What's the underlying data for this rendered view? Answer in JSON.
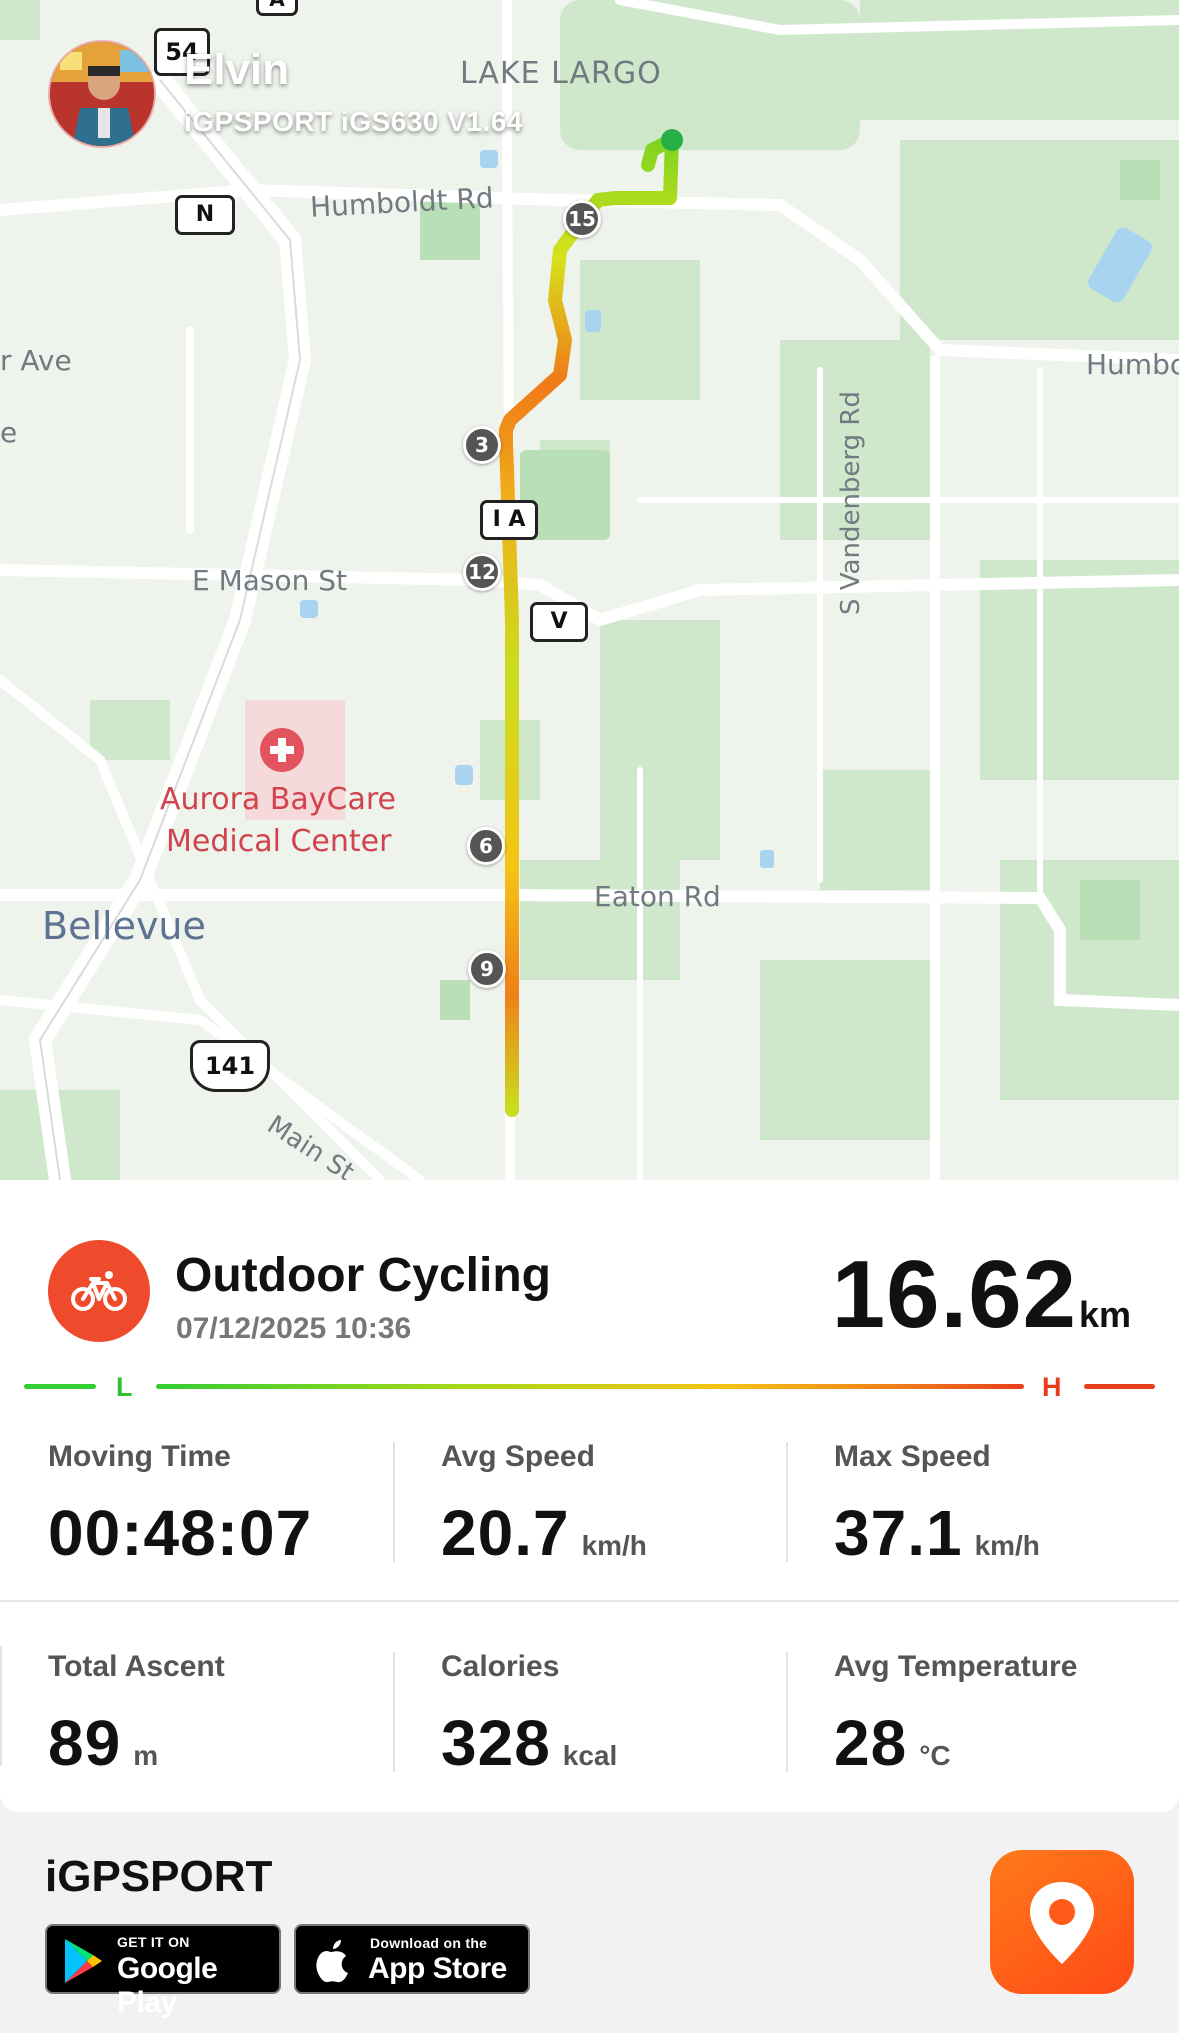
{
  "user": {
    "name": "Elvin",
    "device": "iGPSPORT iGS630 V1.64"
  },
  "map": {
    "labels": {
      "lake_largo": "LAKE LARGO",
      "humboldt_rd": "Humboldt Rd",
      "humboldt_east": "Humbo",
      "r_ave": "r Ave",
      "e_edge": "e",
      "e_mason_st": "E Mason St",
      "s_vandenberg_rd": "S Vandenberg Rd",
      "hospital_line1": "Aurora BayCare",
      "hospital_line2": "Medical Center",
      "bellevue": "Bellevue",
      "eaton_rd": "Eaton Rd",
      "main_st": "Main St"
    },
    "shields": {
      "a": "A",
      "n": "N",
      "s54": "54",
      "ia": "I A",
      "v": "V",
      "us141": "141"
    },
    "lap_markers": [
      "15",
      "3",
      "12",
      "6",
      "9"
    ]
  },
  "activity": {
    "title": "Outdoor Cycling",
    "datetime": "07/12/2025 10:36",
    "distance_value": "16.62",
    "distance_unit": "km",
    "icon": "bicycle-icon",
    "accent_color": "#ef4a2c"
  },
  "legend": {
    "low_label": "L",
    "high_label": "H",
    "low_color": "#32cd32",
    "high_color": "#e83d1d"
  },
  "stats": [
    {
      "label": "Moving Time",
      "value": "00:48:07",
      "unit": ""
    },
    {
      "label": "Avg Speed",
      "value": "20.7",
      "unit": "km/h"
    },
    {
      "label": "Max Speed",
      "value": "37.1",
      "unit": "km/h"
    },
    {
      "label": "Total Ascent",
      "value": "89",
      "unit": "m"
    },
    {
      "label": "Calories",
      "value": "328",
      "unit": "kcal"
    },
    {
      "label": "Avg Temperature",
      "value": "28",
      "unit": "°C"
    }
  ],
  "footer": {
    "brand": "iGPSPORT",
    "google_play_small": "GET IT ON",
    "google_play_big": "Google Play",
    "app_store_small": "Download on the",
    "app_store_big": "App Store",
    "app_icon": "map-pin-icon"
  }
}
